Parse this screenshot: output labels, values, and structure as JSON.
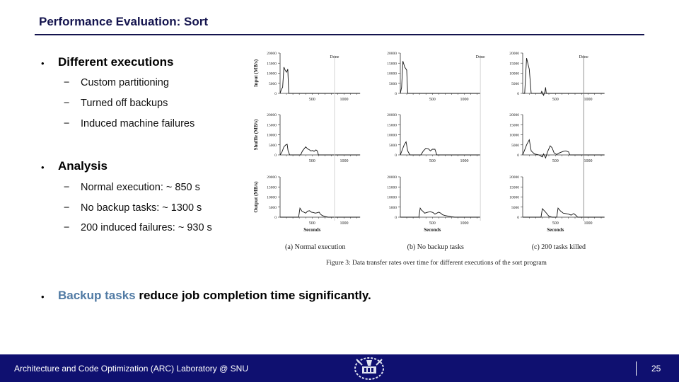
{
  "slide": {
    "title": "Performance Evaluation: Sort",
    "bullets": [
      {
        "text": "Different executions",
        "subitems": [
          "Custom partitioning",
          "Turned off backups",
          "Induced machine failures"
        ]
      },
      {
        "text": "Analysis",
        "subitems": [
          "Normal execution: ~ 850 s",
          "No backup tasks: ~ 1300 s",
          "200 induced failures: ~ 930 s"
        ]
      },
      {
        "highlight": "Backup tasks",
        "text": " reduce job completion time significantly."
      }
    ],
    "bullet_glyph": "•",
    "dash_glyph": "−",
    "highlight_color": "#507aa4"
  },
  "footer": {
    "text": "Architecture and Code Optimization (ARC) Laboratory @ SNU",
    "logo": "snu-emblem-icon",
    "page_number": "25",
    "background": "#0f1070"
  },
  "chart_data": {
    "type": "line",
    "caption": "Figure 3: Data transfer rates over time for different executions of the sort program",
    "xlabel": "Seconds",
    "xticks": [
      500,
      1000
    ],
    "yticks": [
      0,
      5000,
      10000,
      15000,
      20000
    ],
    "ylim": [
      0,
      20000
    ],
    "xlim": [
      0,
      1250
    ],
    "row_labels": [
      "Input (MB/s)",
      "Shuffle (MB/s)",
      "Output (MB/s)"
    ],
    "done_label": "Done",
    "panels": [
      {
        "label": "(a) Normal execution",
        "done": 850,
        "series": {
          "input": [
            [
              0,
              0
            ],
            [
              20,
              2000
            ],
            [
              40,
              3000
            ],
            [
              60,
              13000
            ],
            [
              80,
              11500
            ],
            [
              100,
              10500
            ],
            [
              120,
              12000
            ],
            [
              135,
              0
            ],
            [
              1250,
              0
            ]
          ],
          "shuffle": [
            [
              0,
              0
            ],
            [
              30,
              1500
            ],
            [
              60,
              4000
            ],
            [
              90,
              5000
            ],
            [
              110,
              5300
            ],
            [
              125,
              2000
            ],
            [
              150,
              0
            ],
            [
              320,
              0
            ],
            [
              350,
              2000
            ],
            [
              400,
              4000
            ],
            [
              430,
              3000
            ],
            [
              460,
              2500
            ],
            [
              480,
              2000
            ],
            [
              510,
              2200
            ],
            [
              530,
              1800
            ],
            [
              560,
              2500
            ],
            [
              580,
              2000
            ],
            [
              600,
              0
            ],
            [
              1250,
              0
            ]
          ],
          "output": [
            [
              0,
              0
            ],
            [
              290,
              0
            ],
            [
              310,
              4500
            ],
            [
              340,
              3000
            ],
            [
              370,
              2500
            ],
            [
              400,
              2000
            ],
            [
              430,
              3000
            ],
            [
              460,
              3200
            ],
            [
              490,
              2500
            ],
            [
              520,
              2300
            ],
            [
              550,
              2000
            ],
            [
              580,
              2200
            ],
            [
              610,
              2500
            ],
            [
              630,
              1500
            ],
            [
              660,
              800
            ],
            [
              700,
              300
            ],
            [
              750,
              0
            ],
            [
              1250,
              0
            ]
          ]
        }
      },
      {
        "label": "(b) No backup tasks",
        "done": 1283,
        "series": {
          "input": [
            [
              0,
              0
            ],
            [
              20,
              3000
            ],
            [
              40,
              16000
            ],
            [
              70,
              13000
            ],
            [
              100,
              11500
            ],
            [
              115,
              0
            ],
            [
              1250,
              0
            ]
          ],
          "shuffle": [
            [
              0,
              0
            ],
            [
              30,
              2500
            ],
            [
              60,
              5000
            ],
            [
              90,
              6500
            ],
            [
              115,
              2000
            ],
            [
              150,
              0
            ],
            [
              320,
              0
            ],
            [
              360,
              2000
            ],
            [
              400,
              3300
            ],
            [
              440,
              3000
            ],
            [
              470,
              2000
            ],
            [
              500,
              2800
            ],
            [
              540,
              2800
            ],
            [
              570,
              0
            ],
            [
              1250,
              0
            ]
          ],
          "output": [
            [
              0,
              0
            ],
            [
              290,
              0
            ],
            [
              310,
              4500
            ],
            [
              330,
              3500
            ],
            [
              350,
              3000
            ],
            [
              380,
              2000
            ],
            [
              430,
              2500
            ],
            [
              470,
              2700
            ],
            [
              510,
              2300
            ],
            [
              540,
              1500
            ],
            [
              570,
              2000
            ],
            [
              600,
              2500
            ],
            [
              630,
              2000
            ],
            [
              660,
              1200
            ],
            [
              700,
              800
            ],
            [
              750,
              500
            ],
            [
              800,
              200
            ],
            [
              850,
              0
            ],
            [
              1250,
              0
            ]
          ]
        }
      },
      {
        "label": "(c) 200 tasks killed",
        "done": 933,
        "series": {
          "input": [
            [
              0,
              0
            ],
            [
              30,
              0
            ],
            [
              60,
              17500
            ],
            [
              100,
              12000
            ],
            [
              130,
              0
            ],
            [
              280,
              0
            ],
            [
              290,
              1000
            ],
            [
              300,
              500
            ],
            [
              320,
              -1000
            ],
            [
              340,
              1000
            ],
            [
              350,
              3000
            ],
            [
              360,
              0
            ],
            [
              1250,
              0
            ]
          ],
          "shuffle": [
            [
              0,
              0
            ],
            [
              30,
              2500
            ],
            [
              60,
              5000
            ],
            [
              100,
              7500
            ],
            [
              130,
              2000
            ],
            [
              180,
              500
            ],
            [
              250,
              0
            ],
            [
              300,
              -1000
            ],
            [
              320,
              500
            ],
            [
              350,
              -1500
            ],
            [
              380,
              1500
            ],
            [
              420,
              4500
            ],
            [
              450,
              3500
            ],
            [
              480,
              1000
            ],
            [
              520,
              200
            ],
            [
              560,
              1000
            ],
            [
              620,
              1800
            ],
            [
              660,
              2000
            ],
            [
              700,
              1500
            ],
            [
              720,
              0
            ],
            [
              1250,
              0
            ]
          ],
          "output": [
            [
              0,
              0
            ],
            [
              280,
              0
            ],
            [
              300,
              4200
            ],
            [
              350,
              2500
            ],
            [
              400,
              500
            ],
            [
              450,
              0
            ],
            [
              520,
              0
            ],
            [
              540,
              4500
            ],
            [
              580,
              3000
            ],
            [
              620,
              2000
            ],
            [
              660,
              1800
            ],
            [
              700,
              1500
            ],
            [
              740,
              1000
            ],
            [
              780,
              1800
            ],
            [
              810,
              1000
            ],
            [
              840,
              0
            ],
            [
              1250,
              0
            ]
          ]
        }
      }
    ]
  }
}
